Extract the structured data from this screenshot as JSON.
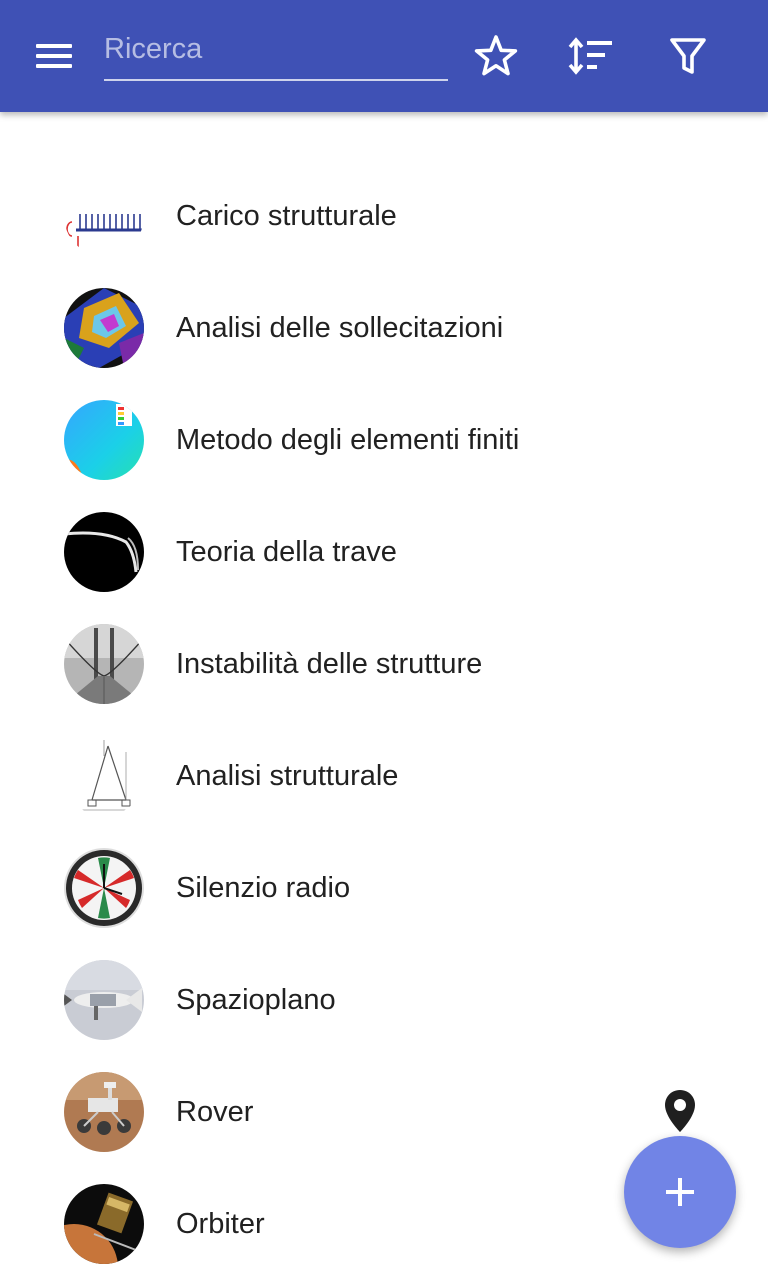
{
  "toolbar": {
    "menu_icon": "menu-icon",
    "search_placeholder": "Ricerca",
    "search_value": "",
    "favorite_icon": "star-outline-icon",
    "sort_icon": "sort-icon",
    "filter_icon": "filter-icon",
    "background_color": "#3f51b5"
  },
  "items": [
    {
      "label": "Carico strutturale",
      "thumbnail": "beam-load-diagram"
    },
    {
      "label": "Analisi delle sollecitazioni",
      "thumbnail": "photoelastic-stress"
    },
    {
      "label": "Metodo degli elementi finiti",
      "thumbnail": "fem-simulation"
    },
    {
      "label": "Teoria della trave",
      "thumbnail": "bent-beam"
    },
    {
      "label": "Instabilità delle strutture",
      "thumbnail": "collapsing-bridge"
    },
    {
      "label": "Analisi strutturale",
      "thumbnail": "truss-diagram"
    },
    {
      "label": "Silenzio radio",
      "thumbnail": "radio-silence-clock"
    },
    {
      "label": "Spazioplano",
      "thumbnail": "space-shuttle"
    },
    {
      "label": "Rover",
      "thumbnail": "mars-rover"
    },
    {
      "label": "Orbiter",
      "thumbnail": "orbiter-spacecraft"
    }
  ],
  "map_pin_icon": "map-pin-icon",
  "fab": {
    "icon": "plus-icon",
    "color": "#7184e6"
  }
}
